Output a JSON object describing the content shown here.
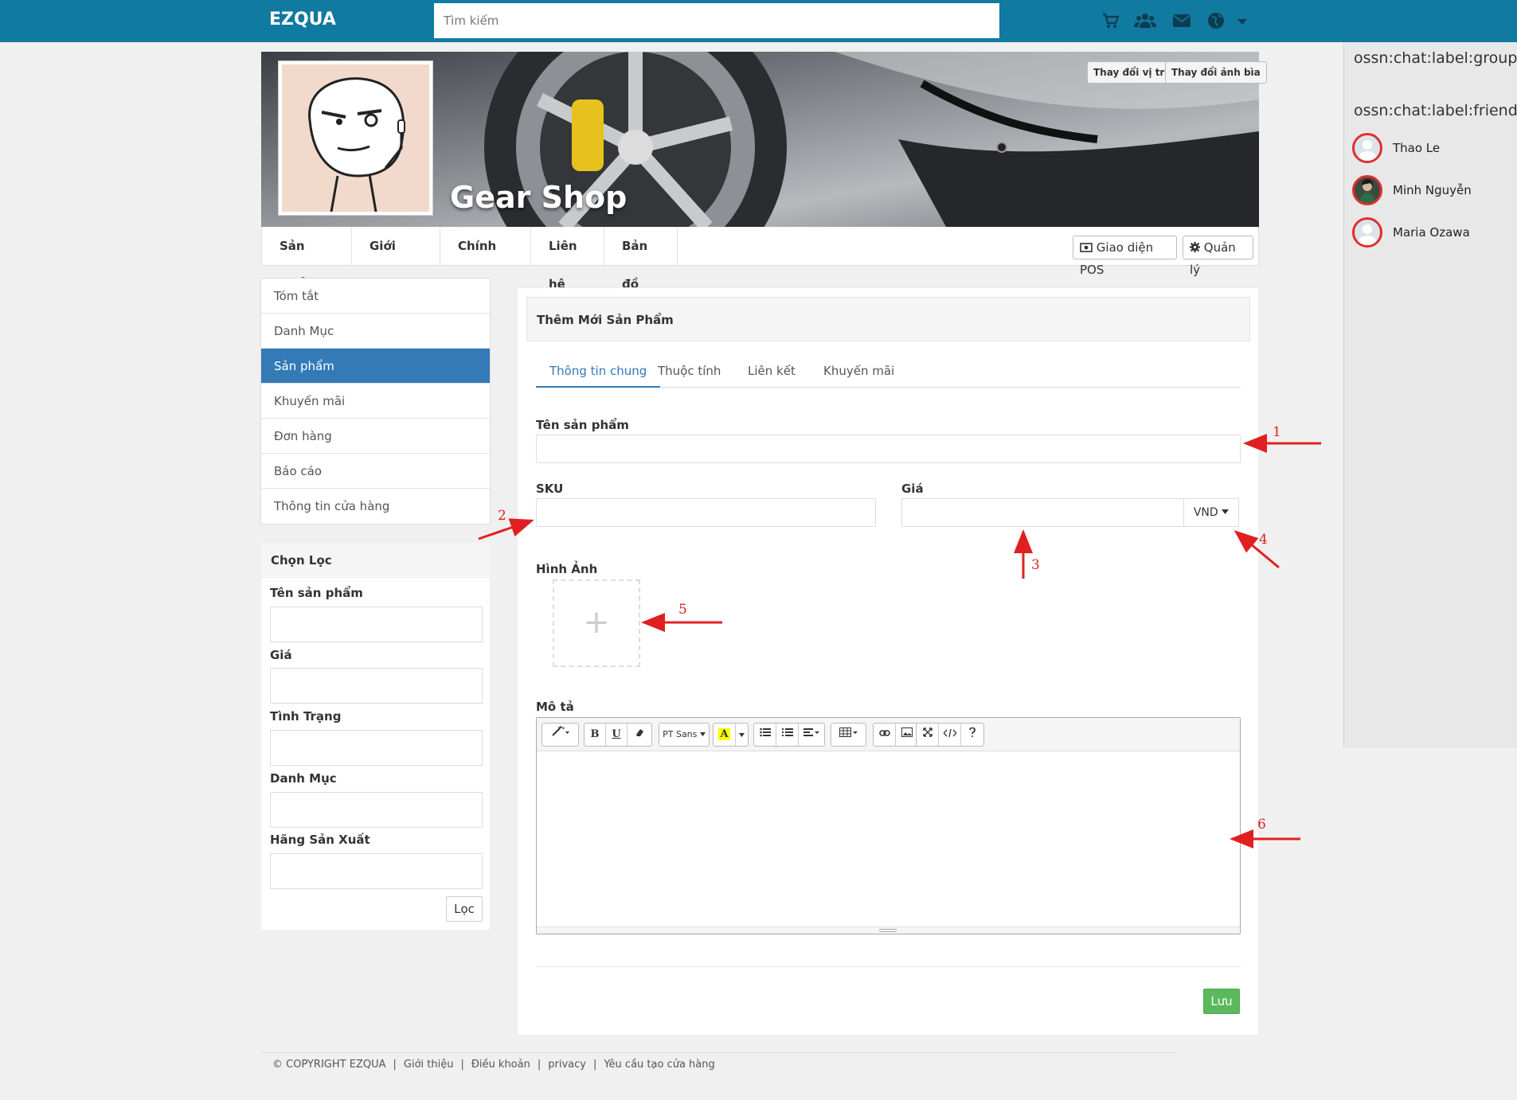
{
  "topbar": {
    "logo": "EZQUA",
    "search_placeholder": "Tìm kiếm",
    "icons": [
      "cart-icon",
      "users-icon",
      "envelope-icon",
      "globe-icon",
      "caret-down-icon"
    ]
  },
  "chat": {
    "groups_label": "ossn:chat:label:groups",
    "friends_label": "ossn:chat:label:friends",
    "friends": [
      {
        "name": "Thao Le"
      },
      {
        "name": "Minh Nguyễn"
      },
      {
        "name": "Maria Ozawa"
      }
    ]
  },
  "cover": {
    "shop_name": "Gear Shop",
    "change_position": "Thay đổi vị trí",
    "change_cover": "Thay đổi ảnh bìa"
  },
  "shop_nav": {
    "items": [
      "Sản phẩm",
      "Giới thiệu",
      "Chính sách",
      "Liên hệ",
      "Bản đồ"
    ],
    "pos_button": "Giao diện POS",
    "manage_button": "Quản lý"
  },
  "sidebar": {
    "items": [
      "Tóm tắt",
      "Danh Mục",
      "Sản phẩm",
      "Khuyến mãi",
      "Đơn hàng",
      "Báo cáo",
      "Thông tin cửa hàng"
    ],
    "active_index": 2
  },
  "filter": {
    "title": "Chọn Lọc",
    "fields": [
      "Tên sản phẩm",
      "Giá",
      "Tình Trạng",
      "Danh Mục",
      "Hãng Sản Xuất"
    ],
    "button": "Lọc"
  },
  "form": {
    "title": "Thêm Mới Sản Phẩm",
    "tabs": [
      "Thông tin chung",
      "Thuộc tính",
      "Liên kết",
      "Khuyến mãi"
    ],
    "active_tab": 0,
    "name_label": "Tên sản phẩm",
    "sku_label": "SKU",
    "price_label": "Giá",
    "currency": "VND",
    "image_label": "Hình Ảnh",
    "image_add": "+",
    "desc_label": "Mô tả",
    "editor_font": "PT Sans",
    "save_button": "Lưu"
  },
  "annotations": [
    "1",
    "2",
    "3",
    "4",
    "5",
    "6"
  ],
  "footer": {
    "copyright": "© COPYRIGHT EZQUA",
    "links": [
      "Giới thiệu",
      "Điều khoản",
      "privacy",
      "Yêu cầu tạo cửa hàng"
    ]
  },
  "colors": {
    "topbar": "#107aa0",
    "active": "#337ab7",
    "save": "#5cb85c",
    "annotation": "#e02020"
  }
}
